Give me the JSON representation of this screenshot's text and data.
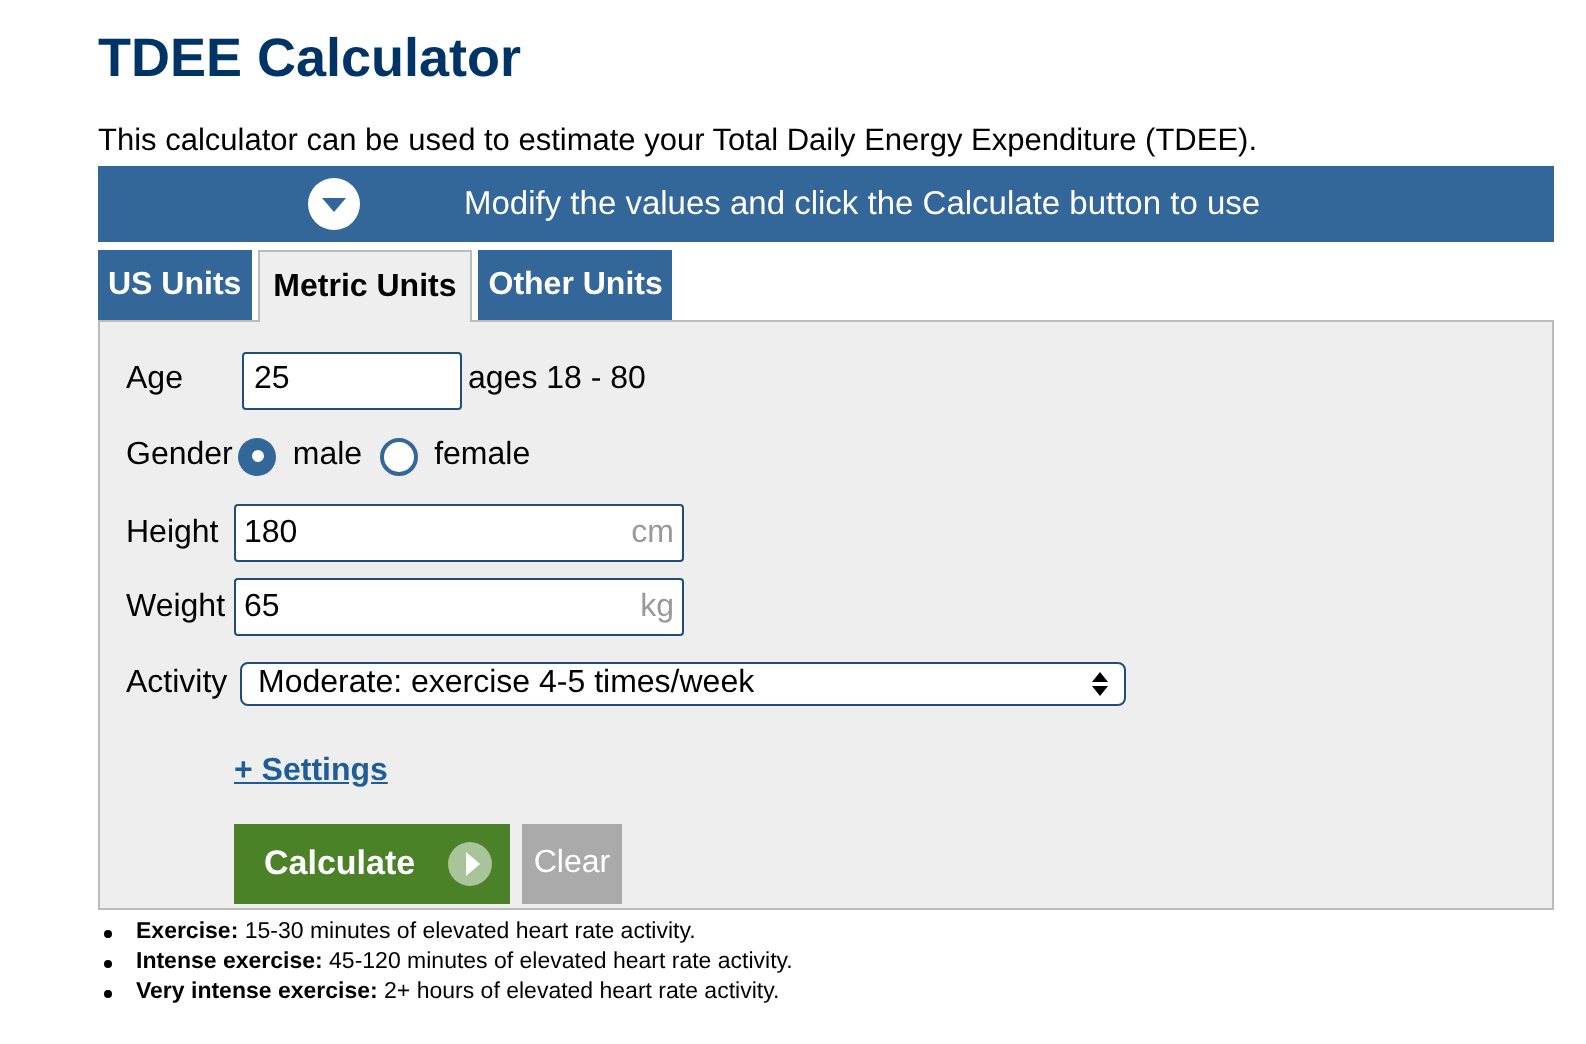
{
  "title": "TDEE Calculator",
  "intro": "This calculator can be used to estimate your Total Daily Energy Expenditure (TDEE).",
  "banner": "Modify the values and click the Calculate button to use",
  "tabs": [
    {
      "label": "US Units",
      "selected": false
    },
    {
      "label": "Metric Units",
      "selected": true
    },
    {
      "label": "Other Units",
      "selected": false
    }
  ],
  "age": {
    "label": "Age",
    "value": "25",
    "hint": "ages 18 - 80"
  },
  "gender": {
    "label": "Gender",
    "options": [
      {
        "label": "male",
        "selected": true
      },
      {
        "label": "female",
        "selected": false
      }
    ]
  },
  "height": {
    "label": "Height",
    "value": "180",
    "unit": "cm"
  },
  "weight": {
    "label": "Weight",
    "value": "65",
    "unit": "kg"
  },
  "activity": {
    "label": "Activity",
    "value": "Moderate: exercise 4-5 times/week"
  },
  "settings_link": "+ Settings",
  "buttons": {
    "calculate": "Calculate",
    "clear": "Clear"
  },
  "notes": [
    "**Exercise:** 15-30 minutes of elevated heart rate activity.",
    "**Intense exercise:** 45-120 minutes of elevated heart rate activity.",
    "**Very intense exercise:** 2+ hours of elevated heart rate activity."
  ]
}
